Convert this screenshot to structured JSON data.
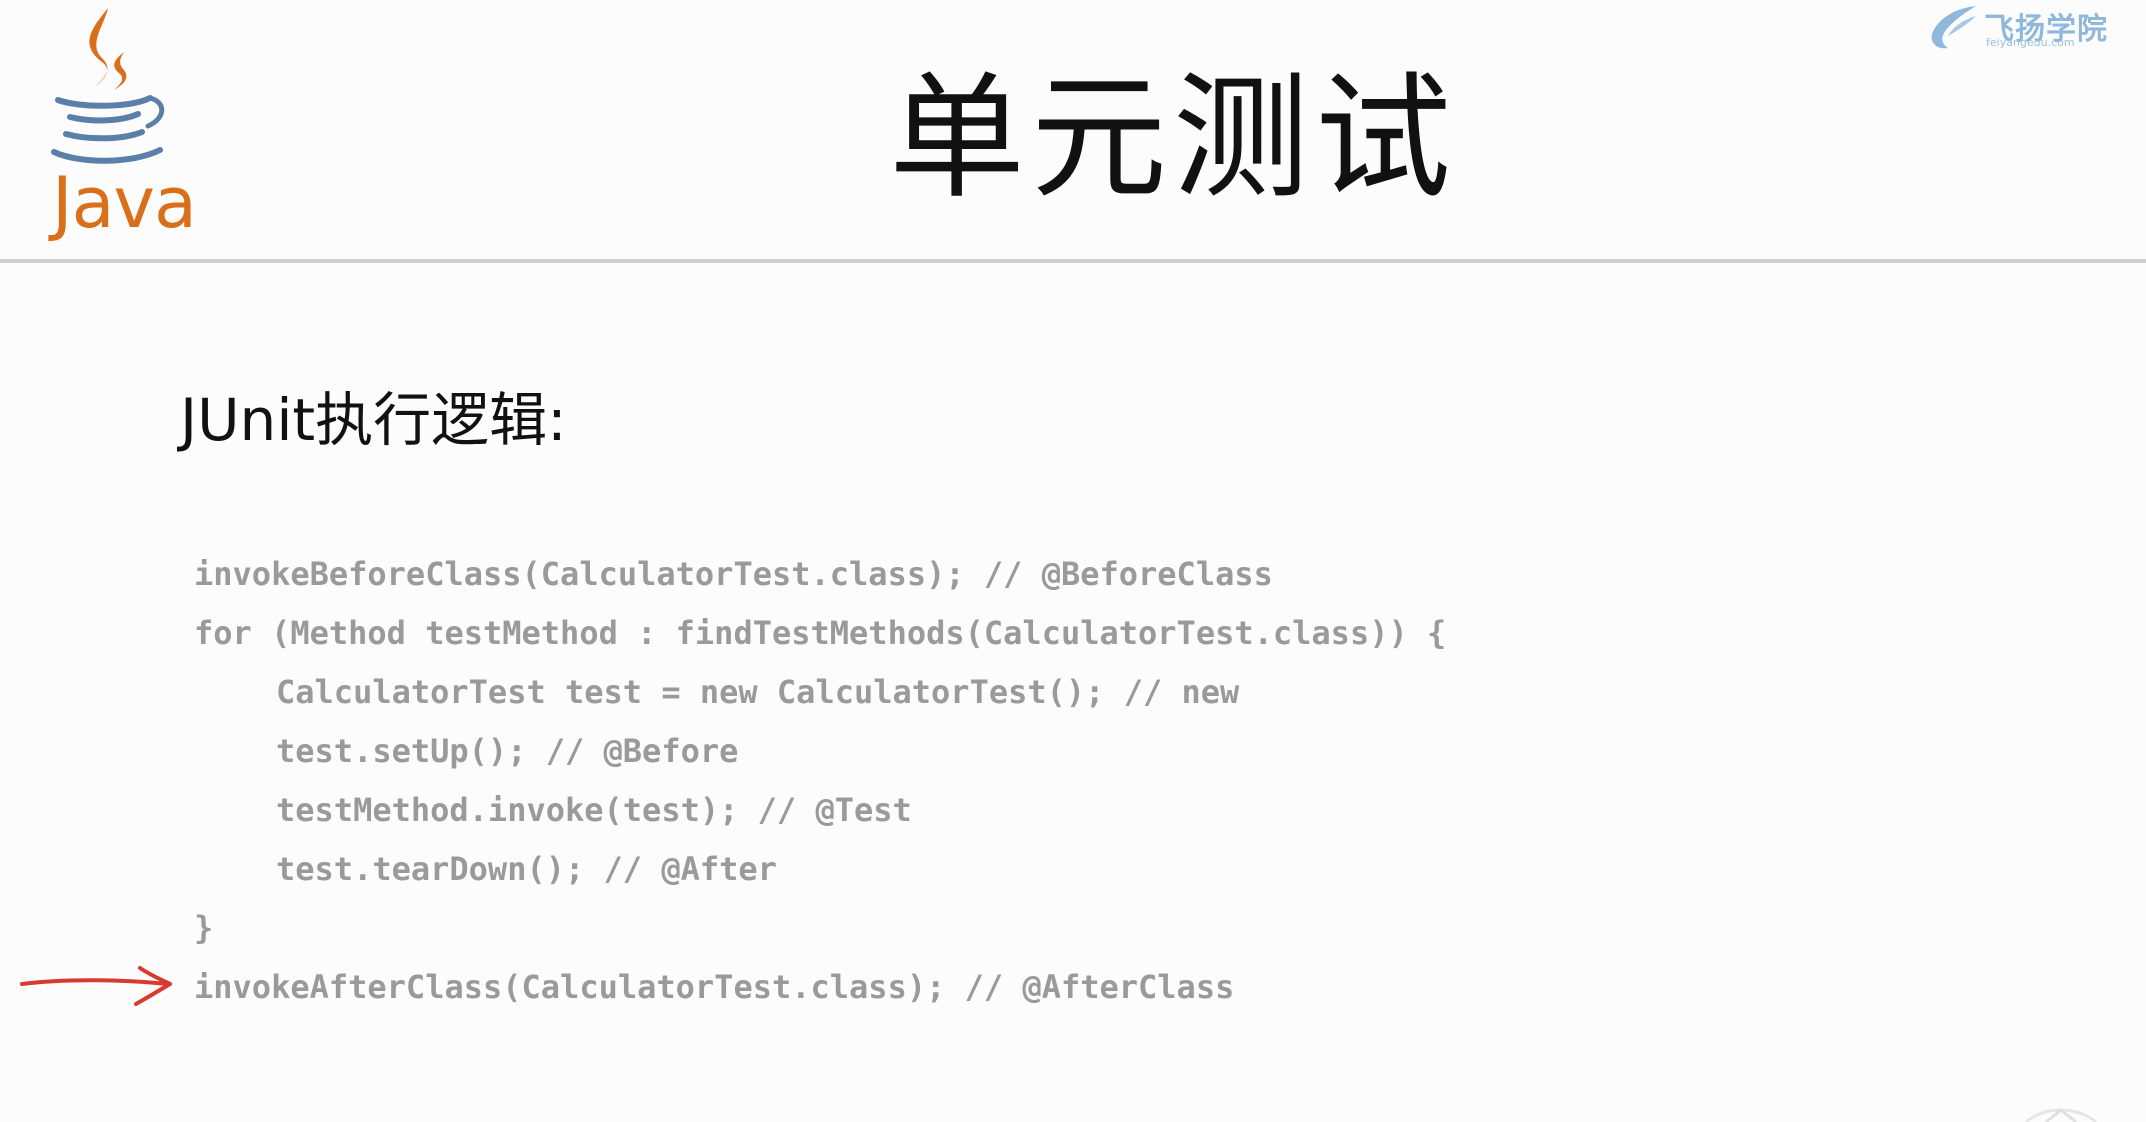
{
  "logo": {
    "word": "Java"
  },
  "brand": {
    "name": "飞扬学院",
    "domain": "feiyangedu.com"
  },
  "slide": {
    "title": "单元测试",
    "subtitle": "JUnit执行逻辑:"
  },
  "code": {
    "lines": [
      "invokeBeforeClass(CalculatorTest.class); // @BeforeClass",
      "for (Method testMethod : findTestMethods(CalculatorTest.class)) {",
      "CalculatorTest test = new CalculatorTest(); // new",
      "test.setUp(); // @Before",
      "testMethod.invoke(test); // @Test",
      "test.tearDown(); // @After",
      "}",
      "invokeAfterClass(CalculatorTest.class); // @AfterClass"
    ]
  },
  "colors": {
    "java_orange": "#d96f1a",
    "java_blue": "#5a7fa8",
    "arrow_red": "#d83a2e",
    "code_gray": "#9a9a9a"
  },
  "icons": [
    "java-logo-icon",
    "brand-logo-icon",
    "red-arrow-icon"
  ]
}
